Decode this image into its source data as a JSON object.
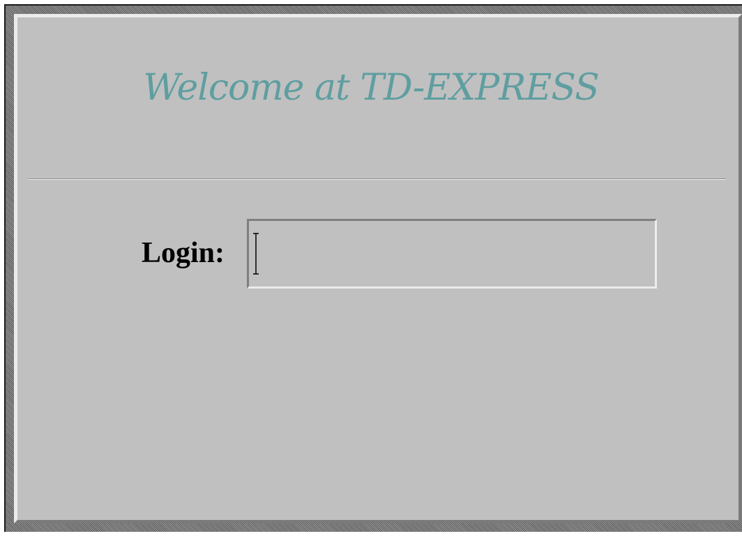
{
  "welcome": {
    "title": "Welcome at TD-EXPRESS"
  },
  "login_form": {
    "label": "Login:",
    "value": "",
    "placeholder": ""
  },
  "colors": {
    "title": "#5f9ea0",
    "panel_background": "#c0c0c0",
    "label_text": "#000000"
  },
  "icons": {
    "text_cursor": "i-beam-cursor-icon"
  }
}
